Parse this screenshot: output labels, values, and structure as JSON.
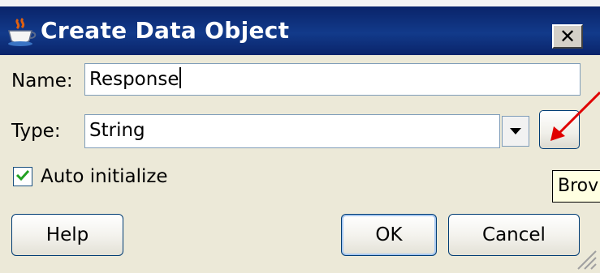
{
  "window": {
    "title": "Create Data Object",
    "close_label": "✕"
  },
  "form": {
    "name_label": "Name:",
    "name_value": "Response",
    "type_label": "Type:",
    "type_value": "String",
    "browse_label": ".",
    "auto_initialize_label": "Auto initialize",
    "auto_initialize_checked": true
  },
  "tooltip": {
    "text": "Brov"
  },
  "buttons": {
    "help": "Help",
    "ok": "OK",
    "cancel": "Cancel"
  },
  "icons": {
    "title_icon": "java-cup-icon",
    "dropdown": "chevron-down-icon",
    "check": "check-icon",
    "annotation": "red-arrow-annotation",
    "resize": "resize-grip-icon"
  },
  "colors": {
    "title_bar": "#0a246a",
    "dialog_bg": "#ece9d8",
    "annotation_arrow": "#e00000",
    "tooltip_bg": "#ffffe1"
  }
}
